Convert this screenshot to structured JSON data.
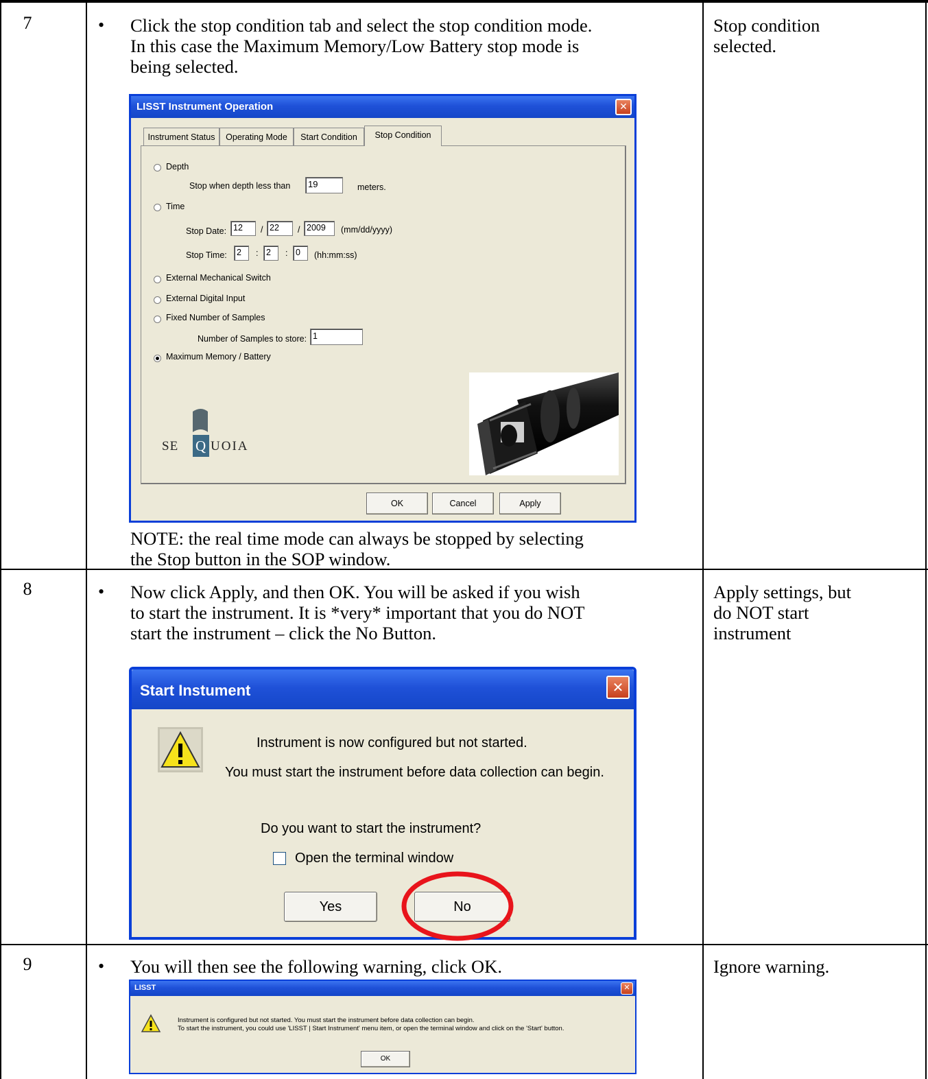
{
  "rows": [
    {
      "step": "7",
      "bullet": "•",
      "instruction": "Click the stop condition tab and select the stop condition mode.\nIn this case the Maximum Memory/Low Battery stop mode is\nbeing selected.",
      "note": "NOTE: the real time mode can always be stopped by selecting\nthe Stop button in the SOP window.",
      "result": "Stop condition\nselected."
    },
    {
      "step": "8",
      "bullet": "•",
      "instruction": "Now click Apply, and then OK. You will be asked if you wish\nto start the instrument.  It is *very* important that you do NOT\nstart the instrument – click the No Button.",
      "result": "Apply settings, but\ndo NOT start\ninstrument"
    },
    {
      "step": "9",
      "bullet": "•",
      "instruction": "You will then see the following warning, click OK.",
      "result": "Ignore warning."
    }
  ],
  "dialog1": {
    "title": "LISST Instrument Operation",
    "close": "✕",
    "tabs": [
      "Instrument Status",
      "Operating Mode",
      "Start Condition",
      "Stop Condition"
    ],
    "active_tab": "Stop Condition",
    "depth_label": "Depth",
    "depth_text": "Stop when depth less than",
    "depth_value": "19",
    "depth_unit": "meters.",
    "time_label": "Time",
    "stop_date_label": "Stop Date:",
    "stop_date_month": "12",
    "stop_date_day": "22",
    "stop_date_year": "2009",
    "date_sep": "/",
    "date_format": "(mm/dd/yyyy)",
    "stop_time_label": "Stop Time:",
    "stop_time_h": "2",
    "stop_time_m": "2",
    "stop_time_s": "0",
    "time_sep": ":",
    "time_format": "(hh:mm:ss)",
    "ext_mech": "External Mechanical Switch",
    "ext_digital": "External Digital Input",
    "fixed_samples": "Fixed Number of Samples",
    "samples_label": "Number of Samples to store:",
    "samples_value": "1",
    "max_memory": "Maximum Memory / Battery",
    "selected_option": "Maximum Memory / Battery",
    "logo_se": "SE",
    "logo_q": "Q",
    "logo_rest": "UOIA",
    "ok": "OK",
    "cancel": "Cancel",
    "apply": "Apply"
  },
  "dialog2": {
    "title": "Start Instument",
    "close": "✕",
    "icon": "warning-icon",
    "line1": "Instrument is now configured but not started.",
    "line2": "You must start the instrument before data collection can begin.",
    "question": "Do you want to start the instrument?",
    "checkbox_label": "Open the terminal window",
    "checkbox_checked": false,
    "yes": "Yes",
    "no": "No",
    "highlight_color": "#e8141b"
  },
  "dialog3": {
    "title": "LISST",
    "close": "✕",
    "icon": "warning-icon",
    "line1": "Instrument is configured but not started. You must start the instrument before data collection can begin.",
    "line2": "To start the instrument, you could use 'LISST | Start Instrument' menu item, or open the terminal window and click on the 'Start' button.",
    "ok": "OK"
  },
  "colors": {
    "titlebar": "#1f51d8",
    "dialog_bg": "#ece9d8",
    "close_btn": "#d8532b",
    "warning": "#f6e21b"
  }
}
